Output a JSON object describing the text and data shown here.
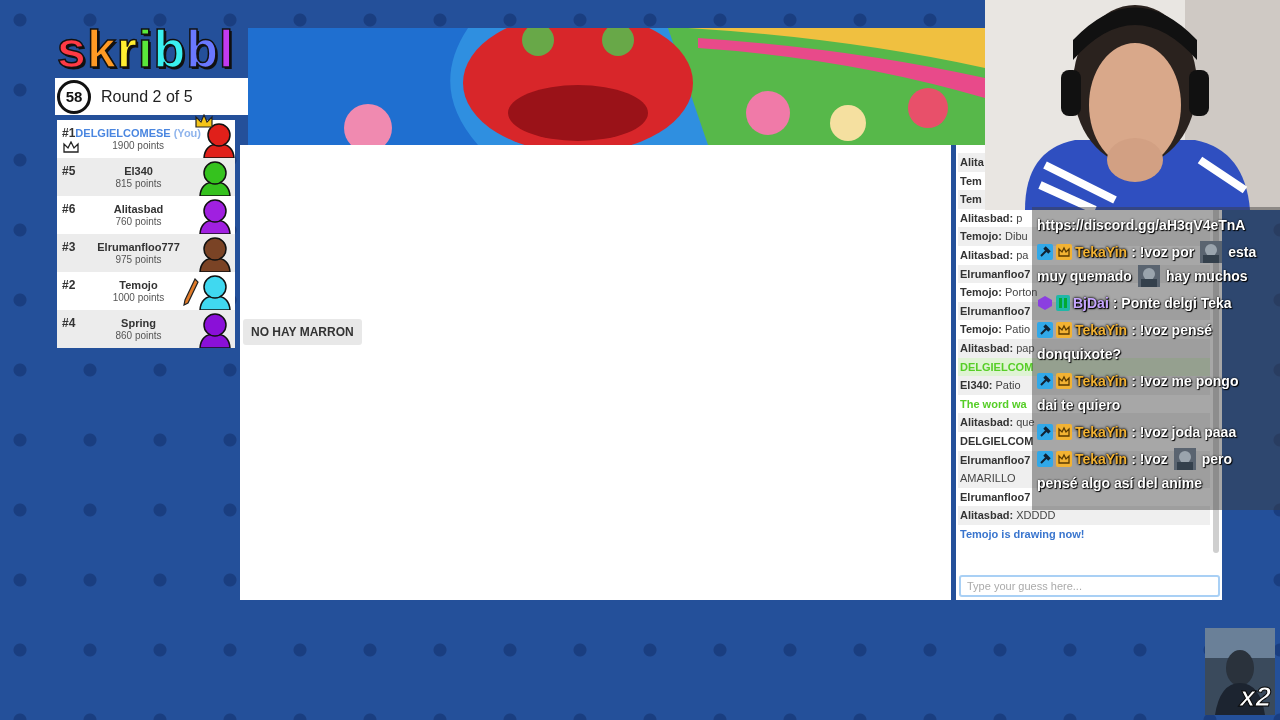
{
  "logo": "skribbl",
  "timer": "58",
  "round": "Round 2 of 5",
  "players": [
    {
      "rank": "#1",
      "name": "DELGIELCOMESE",
      "you_tag": "(You)",
      "points": "1900 points",
      "color": "#e0201a",
      "crown": true,
      "drawing": false
    },
    {
      "rank": "#5",
      "name": "El340",
      "points": "815 points",
      "color": "#35c21e",
      "crown": false,
      "drawing": false
    },
    {
      "rank": "#6",
      "name": "Alitasbad",
      "points": "760 points",
      "color": "#a020e0",
      "crown": false,
      "drawing": false
    },
    {
      "rank": "#3",
      "name": "Elrumanfloo777",
      "points": "975 points",
      "color": "#7a4325",
      "crown": false,
      "drawing": false
    },
    {
      "rank": "#2",
      "name": "Temojo",
      "points": "1000 points",
      "color": "#40d8f0",
      "crown": false,
      "drawing": true
    },
    {
      "rank": "#4",
      "name": "Spring",
      "points": "860 points",
      "color": "#8a10d8",
      "crown": false,
      "drawing": false
    }
  ],
  "speech_bubble": "NO HAY MARRON",
  "chat": {
    "messages": [
      {
        "kind": "msg",
        "name": "Alita"
      },
      {
        "kind": "msg",
        "name": "Tem"
      },
      {
        "kind": "msg",
        "name": "Tem"
      },
      {
        "kind": "msg",
        "name": "Alitasbad:",
        "text": "p"
      },
      {
        "kind": "msg",
        "name": "Temojo:",
        "text": "Dibu"
      },
      {
        "kind": "msg",
        "name": "Alitasbad:",
        "text": "pa"
      },
      {
        "kind": "msg",
        "name": "Elrumanfloo7"
      },
      {
        "kind": "msg",
        "name": "Temojo:",
        "text": "Porton"
      },
      {
        "kind": "msg",
        "name": "Elrumanfloo7"
      },
      {
        "kind": "msg",
        "name": "Temojo:",
        "text": "Patio"
      },
      {
        "kind": "msg",
        "name": "Alitasbad:",
        "text": "pap"
      },
      {
        "kind": "guessed",
        "text": "DELGIELCOM"
      },
      {
        "kind": "msg",
        "name": "El340:",
        "text": "Patio"
      },
      {
        "kind": "reveal",
        "text": "The word wa"
      },
      {
        "kind": "msg",
        "name": "Alitasbad:",
        "text": "que"
      },
      {
        "kind": "msg",
        "name": "DELGIELCOM"
      },
      {
        "kind": "msg",
        "name": "Elrumanfloo7",
        "text": "AMARILLO",
        "line_break": true
      },
      {
        "kind": "msg",
        "name": "Elrumanfloo7"
      },
      {
        "kind": "msg",
        "name": "Alitasbad:",
        "text": "XDDDD"
      },
      {
        "kind": "drawing",
        "text": "Temojo is drawing now!"
      }
    ],
    "placeholder": "Type your guess here..."
  },
  "stream_chat": [
    {
      "kind": "link",
      "text": "https://discord.gg/aH3qV4eTnA"
    },
    {
      "kind": "message",
      "badges": [
        {
          "kind": "mod"
        },
        {
          "kind": "crown"
        }
      ],
      "user": "TekaYin",
      "color": "#f2b233",
      "lines": [
        {
          "parts": [
            {
              "kind": "text",
              "text": ": !voz por"
            },
            {
              "kind": "emote"
            },
            {
              "kind": "text",
              "text": "esta"
            }
          ]
        },
        {
          "parts": [
            {
              "kind": "text",
              "text": "muy quemado"
            },
            {
              "kind": "emote"
            },
            {
              "kind": "text",
              "text": "hay muchos"
            }
          ]
        }
      ]
    },
    {
      "kind": "message",
      "badges": [
        {
          "kind": "gem"
        },
        {
          "kind": "bits"
        }
      ],
      "user": "BjDai",
      "color": "#c6a6ff",
      "lines": [
        {
          "parts": [
            {
              "kind": "text",
              "text": ": Ponte delgi Teka"
            }
          ]
        }
      ]
    },
    {
      "kind": "message",
      "badges": [
        {
          "kind": "mod"
        },
        {
          "kind": "crown"
        }
      ],
      "user": "TekaYin",
      "color": "#f2b233",
      "lines": [
        {
          "parts": [
            {
              "kind": "text",
              "text": ": !voz pensé"
            }
          ]
        },
        {
          "parts": [
            {
              "kind": "text",
              "text": "donquixote?"
            }
          ]
        }
      ]
    },
    {
      "kind": "message",
      "badges": [
        {
          "kind": "mod"
        },
        {
          "kind": "crown"
        }
      ],
      "user": "TekaYin",
      "color": "#f2b233",
      "lines": [
        {
          "parts": [
            {
              "kind": "text",
              "text": ": !voz me pongo"
            }
          ]
        },
        {
          "parts": [
            {
              "kind": "text",
              "text": "dai te quiero"
            }
          ]
        }
      ]
    },
    {
      "kind": "message",
      "badges": [
        {
          "kind": "mod"
        },
        {
          "kind": "crown"
        }
      ],
      "user": "TekaYin",
      "color": "#f2b233",
      "lines": [
        {
          "parts": [
            {
              "kind": "text",
              "text": ": !voz joda paaa"
            }
          ]
        }
      ]
    },
    {
      "kind": "message",
      "badges": [
        {
          "kind": "mod"
        },
        {
          "kind": "crown"
        }
      ],
      "user": "TekaYin",
      "color": "#f2b233",
      "lines": [
        {
          "parts": [
            {
              "kind": "text",
              "text": ": !voz"
            },
            {
              "kind": "emote"
            },
            {
              "kind": "text",
              "text": "pero"
            }
          ]
        },
        {
          "parts": [
            {
              "kind": "text",
              "text": "pensé algo así del anime"
            }
          ]
        }
      ]
    }
  ],
  "multiplier": "x2"
}
